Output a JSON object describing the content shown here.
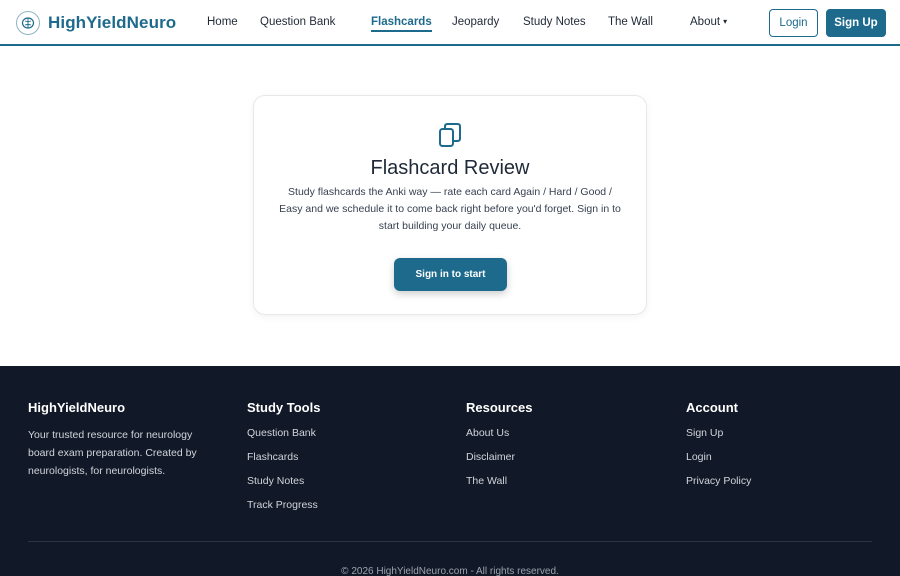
{
  "header": {
    "brand": "HighYieldNeuro",
    "nav": [
      {
        "label": "Home"
      },
      {
        "label": "Question Bank"
      },
      {
        "label": "Flashcards"
      },
      {
        "label": "Jeopardy"
      },
      {
        "label": "Study Notes"
      },
      {
        "label": "The Wall"
      },
      {
        "label": "About"
      }
    ],
    "about_caret": "▾",
    "login_label": "Login",
    "signup_label": "Sign Up"
  },
  "card": {
    "icon": "copy-cards-icon",
    "title": "Flashcard Review",
    "description": "Study flashcards the Anki way — rate each card Again / Hard / Good / Easy and we schedule it to come back right before you'd forget. Sign in to start building your daily queue.",
    "button_label": "Sign in to start"
  },
  "footer": {
    "about": {
      "title": "HighYieldNeuro",
      "text": "Your trusted resource for neurology board exam preparation. Created by neurologists, for neurologists."
    },
    "columns": [
      {
        "title": "Study Tools",
        "links": [
          "Question Bank",
          "Flashcards",
          "Study Notes",
          "Track Progress"
        ]
      },
      {
        "title": "Resources",
        "links": [
          "About Us",
          "Disclaimer",
          "The Wall"
        ]
      },
      {
        "title": "Account",
        "links": [
          "Sign Up",
          "Login",
          "Privacy Policy"
        ]
      }
    ],
    "copyright": "© 2026 HighYieldNeuro.com - All rights reserved."
  },
  "colors": {
    "brand": "#1d6a8c",
    "footer_bg": "#111827"
  }
}
